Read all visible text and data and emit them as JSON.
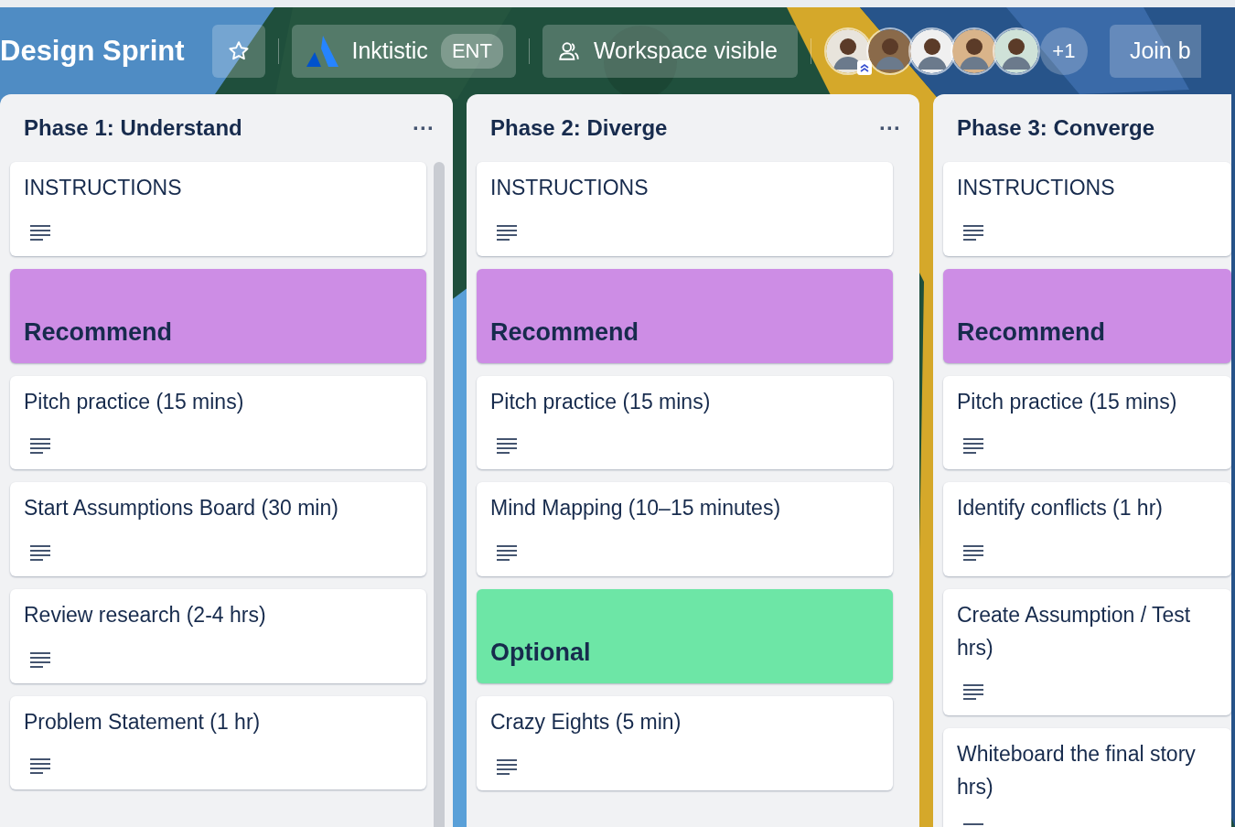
{
  "board": {
    "title": "Design Sprint",
    "starred": false,
    "workspace": {
      "name": "Inktistic",
      "badge": "ENT"
    },
    "visibility": "Workspace visible",
    "members": [
      {
        "admin": true
      },
      {
        "admin": false
      },
      {
        "admin": false
      },
      {
        "admin": false
      },
      {
        "admin": false
      }
    ],
    "more_members": "+1",
    "join_button": "Join b"
  },
  "lists": [
    {
      "title": "Phase 1: Understand",
      "menu": "···",
      "cards": [
        {
          "kind": "text",
          "title": "INSTRUCTIONS"
        },
        {
          "kind": "label",
          "title": "Recommend",
          "color": "#cd8de5"
        },
        {
          "kind": "text",
          "title": "Pitch practice (15 mins)"
        },
        {
          "kind": "text",
          "title": "Start Assumptions Board (30 min)"
        },
        {
          "kind": "text",
          "title": "Review research (2-4 hrs)"
        },
        {
          "kind": "text",
          "title": "Problem Statement (1 hr)"
        }
      ]
    },
    {
      "title": "Phase 2: Diverge",
      "menu": "···",
      "cards": [
        {
          "kind": "text",
          "title": "INSTRUCTIONS"
        },
        {
          "kind": "label",
          "title": "Recommend",
          "color": "#cd8de5"
        },
        {
          "kind": "text",
          "title": "Pitch practice (15 mins)"
        },
        {
          "kind": "text",
          "title": "Mind Mapping (10–15 minutes)"
        },
        {
          "kind": "label",
          "title": "Optional",
          "color": "#6de6a6"
        },
        {
          "kind": "text",
          "title": "Crazy Eights (5 min)"
        }
      ]
    },
    {
      "title": "Phase 3: Converge",
      "cards": [
        {
          "kind": "text",
          "title": "INSTRUCTIONS"
        },
        {
          "kind": "label",
          "title": "Recommend",
          "color": "#cd8de5"
        },
        {
          "kind": "text",
          "title": "Pitch practice (15 mins)"
        },
        {
          "kind": "text",
          "title": "Identify conflicts (1 hr)"
        },
        {
          "kind": "text",
          "title": "Create Assumption / Test\nhrs)"
        },
        {
          "kind": "text",
          "title": "Whiteboard the final story\nhrs)"
        }
      ]
    }
  ]
}
